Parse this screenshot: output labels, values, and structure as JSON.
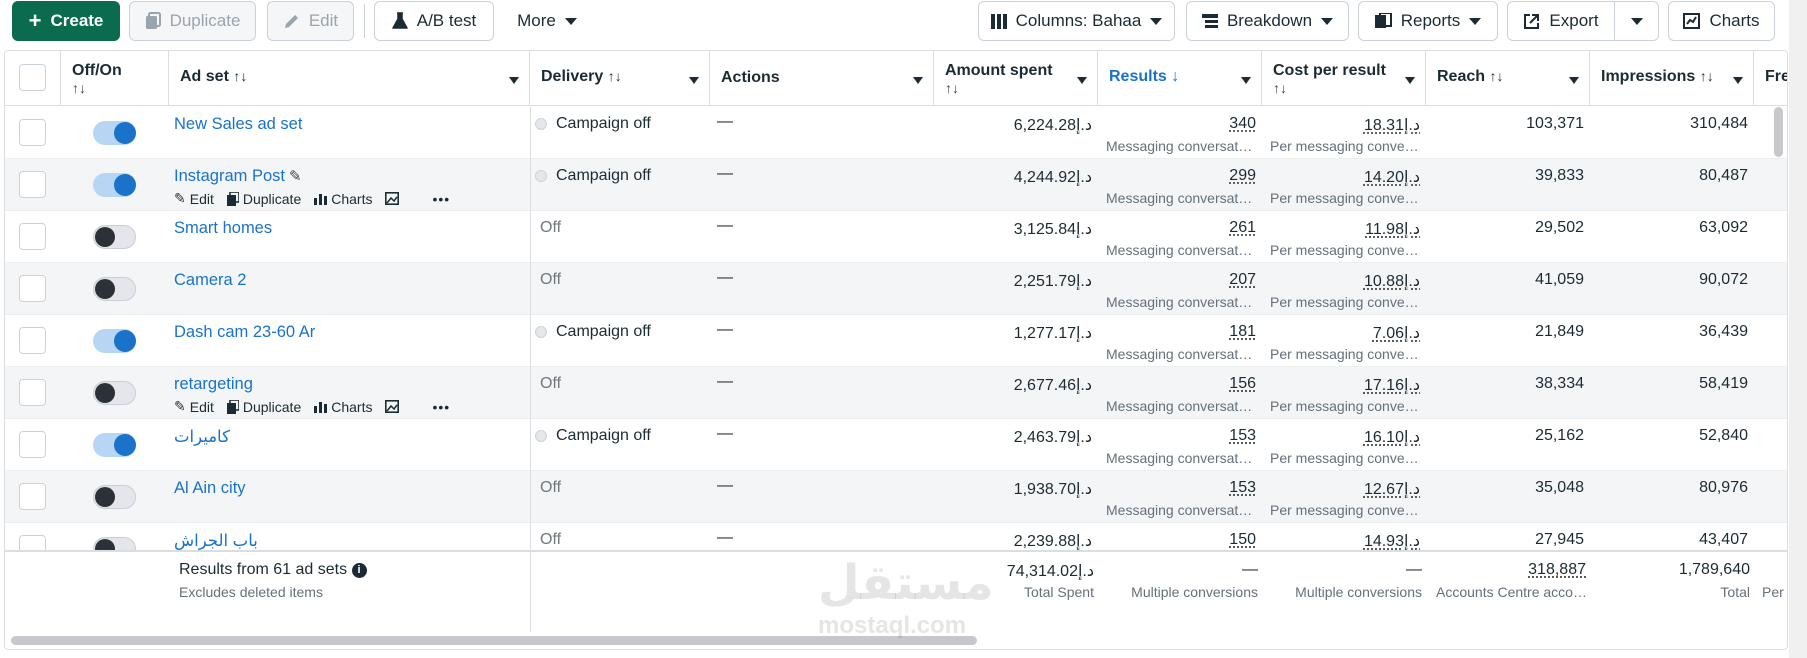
{
  "toolbar": {
    "create": "Create",
    "duplicate": "Duplicate",
    "edit": "Edit",
    "ab_test": "A/B test",
    "more": "More",
    "columns": "Columns: Bahaa",
    "breakdown": "Breakdown",
    "reports": "Reports",
    "export": "Export",
    "charts": "Charts"
  },
  "headers": {
    "offon": "Off/On",
    "adset": "Ad set",
    "delivery": "Delivery",
    "actions": "Actions",
    "amount_spent": "Amount spent",
    "results": "Results",
    "cost_per_result": "Cost per result",
    "reach": "Reach",
    "impressions": "Impressions",
    "frequency": "Fre",
    "sort_icon": "↑↓",
    "sort_desc_icon": "↓"
  },
  "row_actions": {
    "edit": "Edit",
    "duplicate": "Duplicate",
    "charts": "Charts",
    "more": "•••"
  },
  "rows": [
    {
      "name": "New Sales ad set",
      "on": true,
      "delivery": "Campaign off",
      "delivery_off": false,
      "actions": "—",
      "spent": "6,224.28د.إ",
      "results": "340",
      "results_sub": "Messaging conversat…",
      "cpr": "18.31د.إ",
      "cpr_sub": "Per messaging conve…",
      "reach": "103,371",
      "impressions": "310,484",
      "show_actions": false,
      "pencil": false
    },
    {
      "name": "Instagram Post",
      "on": true,
      "delivery": "Campaign off",
      "delivery_off": false,
      "actions": "—",
      "spent": "4,244.92د.إ",
      "results": "299",
      "results_sub": "Messaging conversat…",
      "cpr": "14.20د.إ",
      "cpr_sub": "Per messaging conve…",
      "reach": "39,833",
      "impressions": "80,487",
      "show_actions": true,
      "pencil": true
    },
    {
      "name": "Smart homes",
      "on": false,
      "delivery": "Off",
      "delivery_off": true,
      "actions": "—",
      "spent": "3,125.84د.إ",
      "results": "261",
      "results_sub": "Messaging conversat…",
      "cpr": "11.98د.إ",
      "cpr_sub": "Per messaging conve…",
      "reach": "29,502",
      "impressions": "63,092",
      "show_actions": false,
      "pencil": false
    },
    {
      "name": "Camera 2",
      "on": false,
      "delivery": "Off",
      "delivery_off": true,
      "actions": "—",
      "spent": "2,251.79د.إ",
      "results": "207",
      "results_sub": "Messaging conversat…",
      "cpr": "10.88د.إ",
      "cpr_sub": "Per messaging conve…",
      "reach": "41,059",
      "impressions": "90,072",
      "show_actions": false,
      "pencil": false
    },
    {
      "name": "Dash cam 23-60 Ar",
      "on": true,
      "delivery": "Campaign off",
      "delivery_off": false,
      "actions": "—",
      "spent": "1,277.17د.إ",
      "results": "181",
      "results_sub": "Messaging conversat…",
      "cpr": "7.06د.إ",
      "cpr_sub": "Per messaging conve…",
      "reach": "21,849",
      "impressions": "36,439",
      "show_actions": false,
      "pencil": false
    },
    {
      "name": "retargeting",
      "on": false,
      "delivery": "Off",
      "delivery_off": true,
      "actions": "—",
      "spent": "2,677.46د.إ",
      "results": "156",
      "results_sub": "Messaging conversat…",
      "cpr": "17.16د.إ",
      "cpr_sub": "Per messaging conve…",
      "reach": "38,334",
      "impressions": "58,419",
      "show_actions": true,
      "pencil": false
    },
    {
      "name": "كاميرات",
      "on": true,
      "delivery": "Campaign off",
      "delivery_off": false,
      "actions": "—",
      "spent": "2,463.79د.إ",
      "results": "153",
      "results_sub": "Messaging conversat…",
      "cpr": "16.10د.إ",
      "cpr_sub": "Per messaging conve…",
      "reach": "25,162",
      "impressions": "52,840",
      "show_actions": false,
      "pencil": false
    },
    {
      "name": "Al Ain city",
      "on": false,
      "delivery": "Off",
      "delivery_off": true,
      "actions": "—",
      "spent": "1,938.70د.إ",
      "results": "153",
      "results_sub": "Messaging conversat…",
      "cpr": "12.67د.إ",
      "cpr_sub": "Per messaging conve…",
      "reach": "35,048",
      "impressions": "80,976",
      "show_actions": false,
      "pencil": false
    },
    {
      "name": "باب الجراش",
      "on": false,
      "delivery": "Off",
      "delivery_off": true,
      "actions": "—",
      "spent": "2,239.88د.إ",
      "results": "150",
      "results_sub": "",
      "cpr": "14.93د.إ",
      "cpr_sub": "",
      "reach": "27,945",
      "impressions": "43,407",
      "show_actions": false,
      "pencil": false
    }
  ],
  "footer": {
    "results_text": "Results from 61 ad sets",
    "info_icon": "i",
    "excludes": "Excludes deleted items",
    "total_spent_value": "74,314.02د.إ",
    "total_spent_label": "Total Spent",
    "results_value": "—",
    "results_label": "Multiple conversions",
    "cpr_value": "—",
    "cpr_label": "Multiple conversions",
    "reach_value": "318,887",
    "reach_label": "Accounts Centre acco…",
    "impressions_value": "1,789,640",
    "impressions_label": "Total",
    "frequency_label": "Per"
  },
  "watermark": {
    "arabic": "مستقل",
    "latin": "mostaql.com"
  },
  "colors": {
    "primary": "#0b6b4f",
    "link": "#1a73c8",
    "toggle_on": "#1a73c8"
  }
}
